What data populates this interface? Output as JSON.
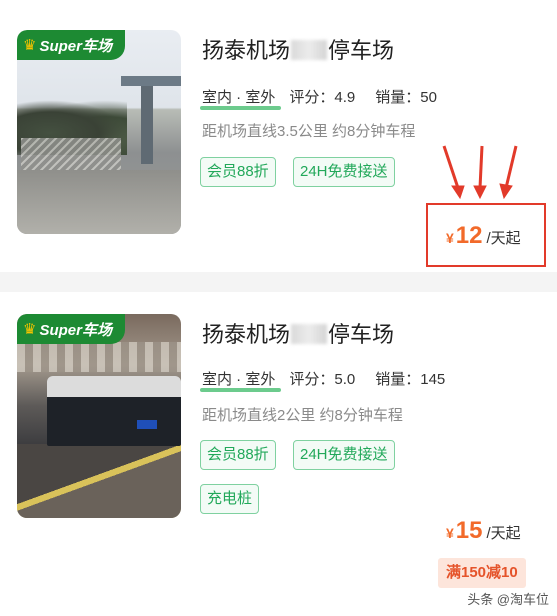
{
  "listings": [
    {
      "badge": "Super车场",
      "title_left": "扬泰机场",
      "title_right": "停车场",
      "location_type": "室内 · 室外",
      "rating_label": "评分：",
      "rating": "4.9",
      "sales_label": "销量：",
      "sales": "50",
      "distance": "距机场直线3.5公里 约8分钟车程",
      "tags": [
        "会员88折",
        "24H免费接送"
      ],
      "currency": "¥",
      "price": "12",
      "price_unit": "/天起"
    },
    {
      "badge": "Super车场",
      "title_left": "扬泰机场",
      "title_right": "停车场",
      "location_type": "室内 · 室外",
      "rating_label": "评分：",
      "rating": "5.0",
      "sales_label": "销量：",
      "sales": "145",
      "distance": "距机场直线2公里 约8分钟车程",
      "tags": [
        "会员88折",
        "24H免费接送",
        "充电桩"
      ],
      "currency": "¥",
      "price": "15",
      "price_unit": "/天起",
      "promo": "满150减10"
    }
  ],
  "watermark": "头条 @淘车位",
  "colors": {
    "accent_green": "#22a85a",
    "badge_green": "#1d8a33",
    "price_orange": "#f26a2a",
    "highlight_red": "#e23a2a"
  }
}
